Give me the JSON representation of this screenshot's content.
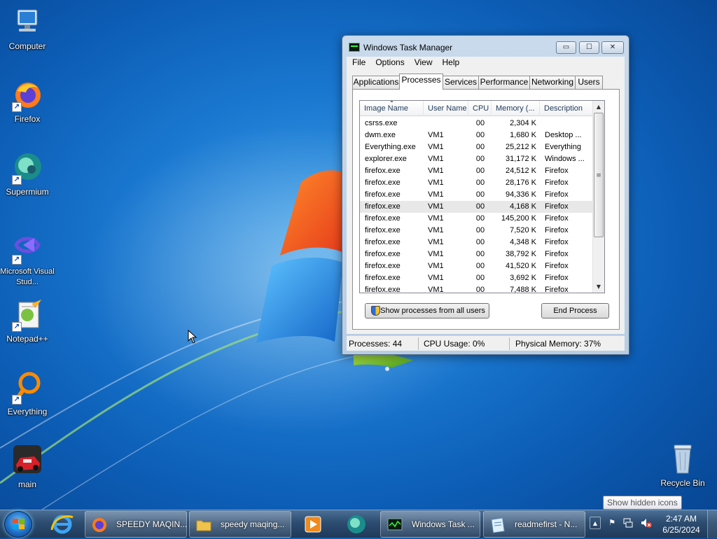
{
  "desktop": {
    "icons": [
      {
        "label": "Computer",
        "icon": "computer-icon"
      },
      {
        "label": "Firefox",
        "icon": "firefox-icon"
      },
      {
        "label": "Supermium",
        "icon": "supermium-icon"
      },
      {
        "label": "Microsoft Visual Stud...",
        "icon": "visual-studio-icon"
      },
      {
        "label": "Notepad++",
        "icon": "notepadpp-icon"
      },
      {
        "label": "Everything",
        "icon": "everything-icon"
      },
      {
        "label": "main",
        "icon": "game-icon"
      }
    ],
    "recycle_bin": {
      "label": "Recycle Bin",
      "icon": "recycle-bin-icon"
    }
  },
  "task_manager": {
    "title": "Windows Task Manager",
    "caption": {
      "minimize": "▭",
      "maximize": "☐",
      "close": "✕"
    },
    "menu": [
      "File",
      "Options",
      "View",
      "Help"
    ],
    "tabs": [
      "Applications",
      "Processes",
      "Services",
      "Performance",
      "Networking",
      "Users"
    ],
    "active_tab": "Processes",
    "columns": [
      "Image Name",
      "User Name",
      "CPU",
      "Memory (...",
      "Description"
    ],
    "processes": [
      {
        "name": "csrss.exe",
        "user": "",
        "cpu": "00",
        "mem": "2,304 K",
        "desc": ""
      },
      {
        "name": "dwm.exe",
        "user": "VM1",
        "cpu": "00",
        "mem": "1,680 K",
        "desc": "Desktop ..."
      },
      {
        "name": "Everything.exe",
        "user": "VM1",
        "cpu": "00",
        "mem": "25,212 K",
        "desc": "Everything"
      },
      {
        "name": "explorer.exe",
        "user": "VM1",
        "cpu": "00",
        "mem": "31,172 K",
        "desc": "Windows ..."
      },
      {
        "name": "firefox.exe",
        "user": "VM1",
        "cpu": "00",
        "mem": "24,512 K",
        "desc": "Firefox"
      },
      {
        "name": "firefox.exe",
        "user": "VM1",
        "cpu": "00",
        "mem": "28,176 K",
        "desc": "Firefox"
      },
      {
        "name": "firefox.exe",
        "user": "VM1",
        "cpu": "00",
        "mem": "94,336 K",
        "desc": "Firefox"
      },
      {
        "name": "firefox.exe",
        "user": "VM1",
        "cpu": "00",
        "mem": "4,168 K",
        "desc": "Firefox",
        "selected": true
      },
      {
        "name": "firefox.exe",
        "user": "VM1",
        "cpu": "00",
        "mem": "145,200 K",
        "desc": "Firefox"
      },
      {
        "name": "firefox.exe",
        "user": "VM1",
        "cpu": "00",
        "mem": "7,520 K",
        "desc": "Firefox"
      },
      {
        "name": "firefox.exe",
        "user": "VM1",
        "cpu": "00",
        "mem": "4,348 K",
        "desc": "Firefox"
      },
      {
        "name": "firefox.exe",
        "user": "VM1",
        "cpu": "00",
        "mem": "38,792 K",
        "desc": "Firefox"
      },
      {
        "name": "firefox.exe",
        "user": "VM1",
        "cpu": "00",
        "mem": "41,520 K",
        "desc": "Firefox"
      },
      {
        "name": "firefox.exe",
        "user": "VM1",
        "cpu": "00",
        "mem": "3,692 K",
        "desc": "Firefox"
      },
      {
        "name": "firefox.exe",
        "user": "VM1",
        "cpu": "00",
        "mem": "7,488 K",
        "desc": "Firefox"
      }
    ],
    "buttons": {
      "show_all": "Show processes from all users",
      "end_process": "End Process"
    },
    "status": {
      "processes": "Processes: 44",
      "cpu": "CPU Usage: 0%",
      "memory": "Physical Memory: 37%"
    }
  },
  "taskbar": {
    "pinned": [
      {
        "icon": "internet-explorer-icon"
      },
      {
        "icon": "media-player-icon"
      },
      {
        "icon": "supermium-icon"
      }
    ],
    "items": [
      {
        "label": "SPEEDY MAQIN...",
        "icon": "firefox-icon"
      },
      {
        "label": "speedy maqing...",
        "icon": "folder-icon"
      },
      {
        "label": "Windows Task ...",
        "icon": "task-manager-icon"
      },
      {
        "label": "readmefirst - N...",
        "icon": "notepad-icon"
      }
    ],
    "tray": {
      "tooltip": "Show hidden icons",
      "time": "2:47 AM",
      "date": "6/25/2024"
    }
  },
  "colors": {
    "accent": "#1a78d0",
    "selection": "#e8e8e8",
    "taskbar": "#2c4c70"
  }
}
